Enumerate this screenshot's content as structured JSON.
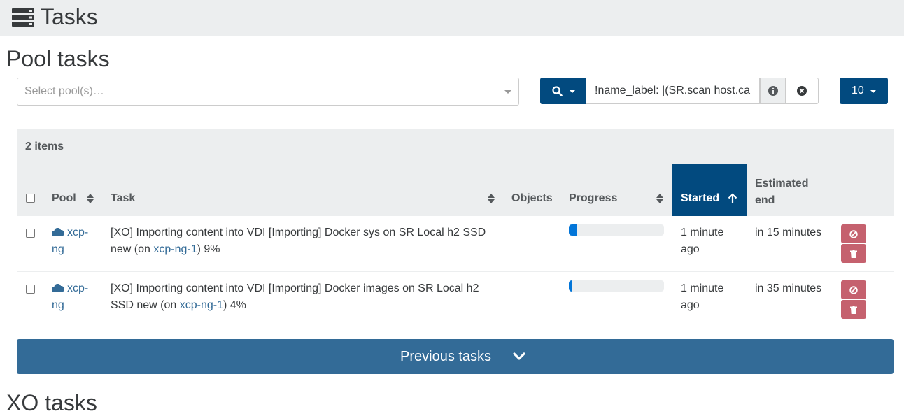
{
  "header": {
    "title": "Tasks",
    "icon": "tasks-icon"
  },
  "pool_section": {
    "title": "Pool tasks",
    "pool_select": {
      "placeholder": "Select pool(s)…"
    },
    "filter": {
      "value": "!name_label: |(SR.scan host.ca"
    },
    "page_size": "10",
    "items_count": "2 items",
    "columns": {
      "pool": "Pool",
      "task": "Task",
      "objects": "Objects",
      "progress": "Progress",
      "started": "Started",
      "estimated_end": "Estimated end"
    },
    "rows": [
      {
        "pool": "xcp-ng",
        "task_text": "[XO] Importing content into VDI [Importing] Docker sys on SR Local h2 SSD new (on ",
        "host_link": "xcp-ng-1",
        "task_suffix": ") 9%",
        "progress": 0.09,
        "started": "1 minute ago",
        "estimated_end": "in 15 minutes"
      },
      {
        "pool": "xcp-ng",
        "task_text": "[XO] Importing content into VDI [Importing] Docker images on SR Local h2 SSD new (on ",
        "host_link": "xcp-ng-1",
        "task_suffix": ") 4%",
        "progress": 0.04,
        "started": "1 minute ago",
        "estimated_end": "in 35 minutes"
      }
    ],
    "previous_tasks_label": "Previous tasks"
  },
  "xo_section": {
    "title": "XO tasks"
  },
  "colors": {
    "primary": "#024a7f",
    "danger": "#c5616e",
    "link": "#336b97",
    "progress": "#0275d8"
  }
}
